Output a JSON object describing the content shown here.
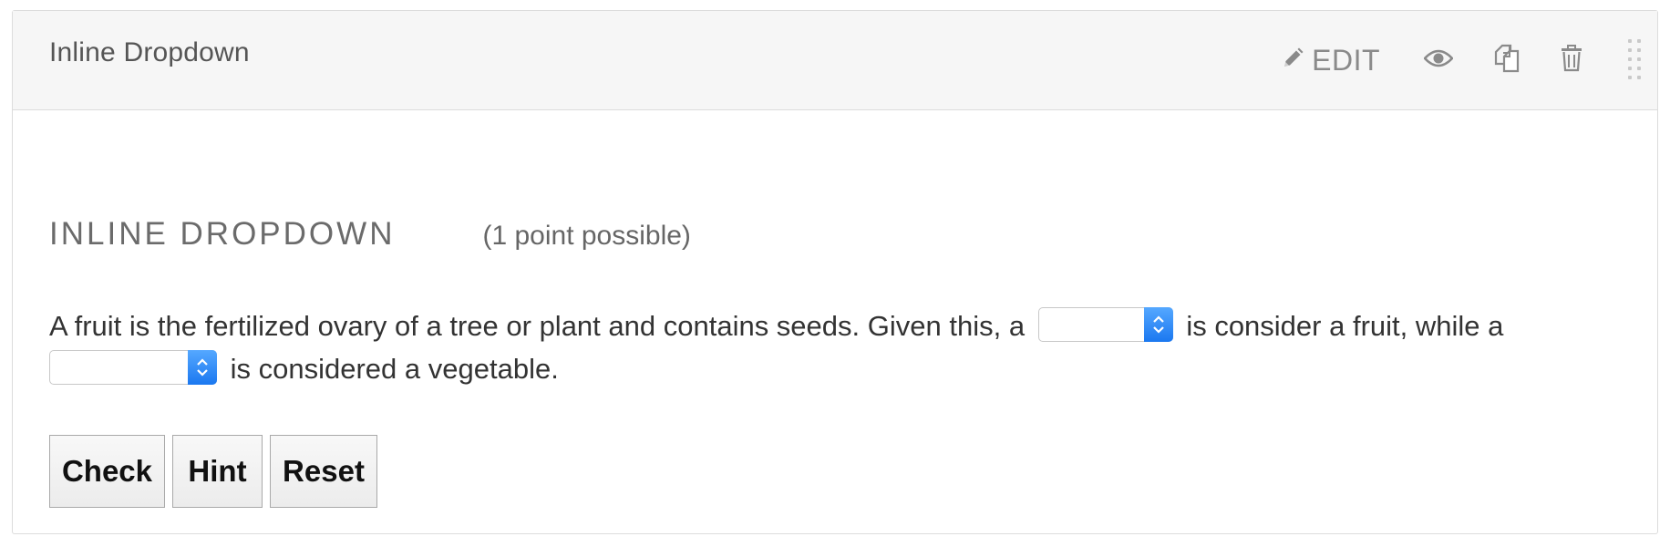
{
  "header": {
    "title": "Inline Dropdown",
    "edit_label": "EDIT",
    "icons": [
      "pencil-icon",
      "eye-icon",
      "duplicate-icon",
      "trash-icon",
      "drag-handle-icon"
    ]
  },
  "problem": {
    "name": "INLINE DROPDOWN",
    "points": "(1 point possible)",
    "text_part1": "A fruit is the fertilized ovary of a tree or plant and contains seeds. Given this, a",
    "text_part2": "is consider a fruit, while a",
    "text_part3": "is considered a vegetable.",
    "dropdown_1_value": "",
    "dropdown_2_value": ""
  },
  "buttons": {
    "check": "Check",
    "hint": "Hint",
    "reset": "Reset"
  },
  "colors": {
    "header_bg": "#f6f6f6",
    "select_accent": "#1b78f0",
    "icon_gray": "#8a8a8a"
  }
}
